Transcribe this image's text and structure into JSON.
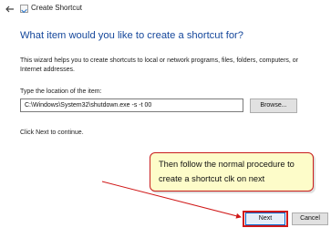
{
  "window": {
    "title": "Create Shortcut"
  },
  "wizard": {
    "heading": "What item would you like to create a shortcut for?",
    "description": "This wizard helps you to create shortcuts to local or network programs, files, folders, computers, or Internet addresses.",
    "location_label": "Type the location of the item:",
    "location_value": "C:\\Windows\\System32\\shutdown.exe -s -t 00",
    "browse_label": "Browse...",
    "next_hint": "Click Next to continue."
  },
  "buttons": {
    "next_label": "Next",
    "cancel_label": "Cancel"
  },
  "annotation": {
    "text": "Then follow the normal procedure to create a shortcut clk on next"
  },
  "colors": {
    "heading": "#15479b",
    "annotation_border": "#c81d1d",
    "annotation_fill": "#fdfcc9",
    "arrow": "#d01818"
  }
}
